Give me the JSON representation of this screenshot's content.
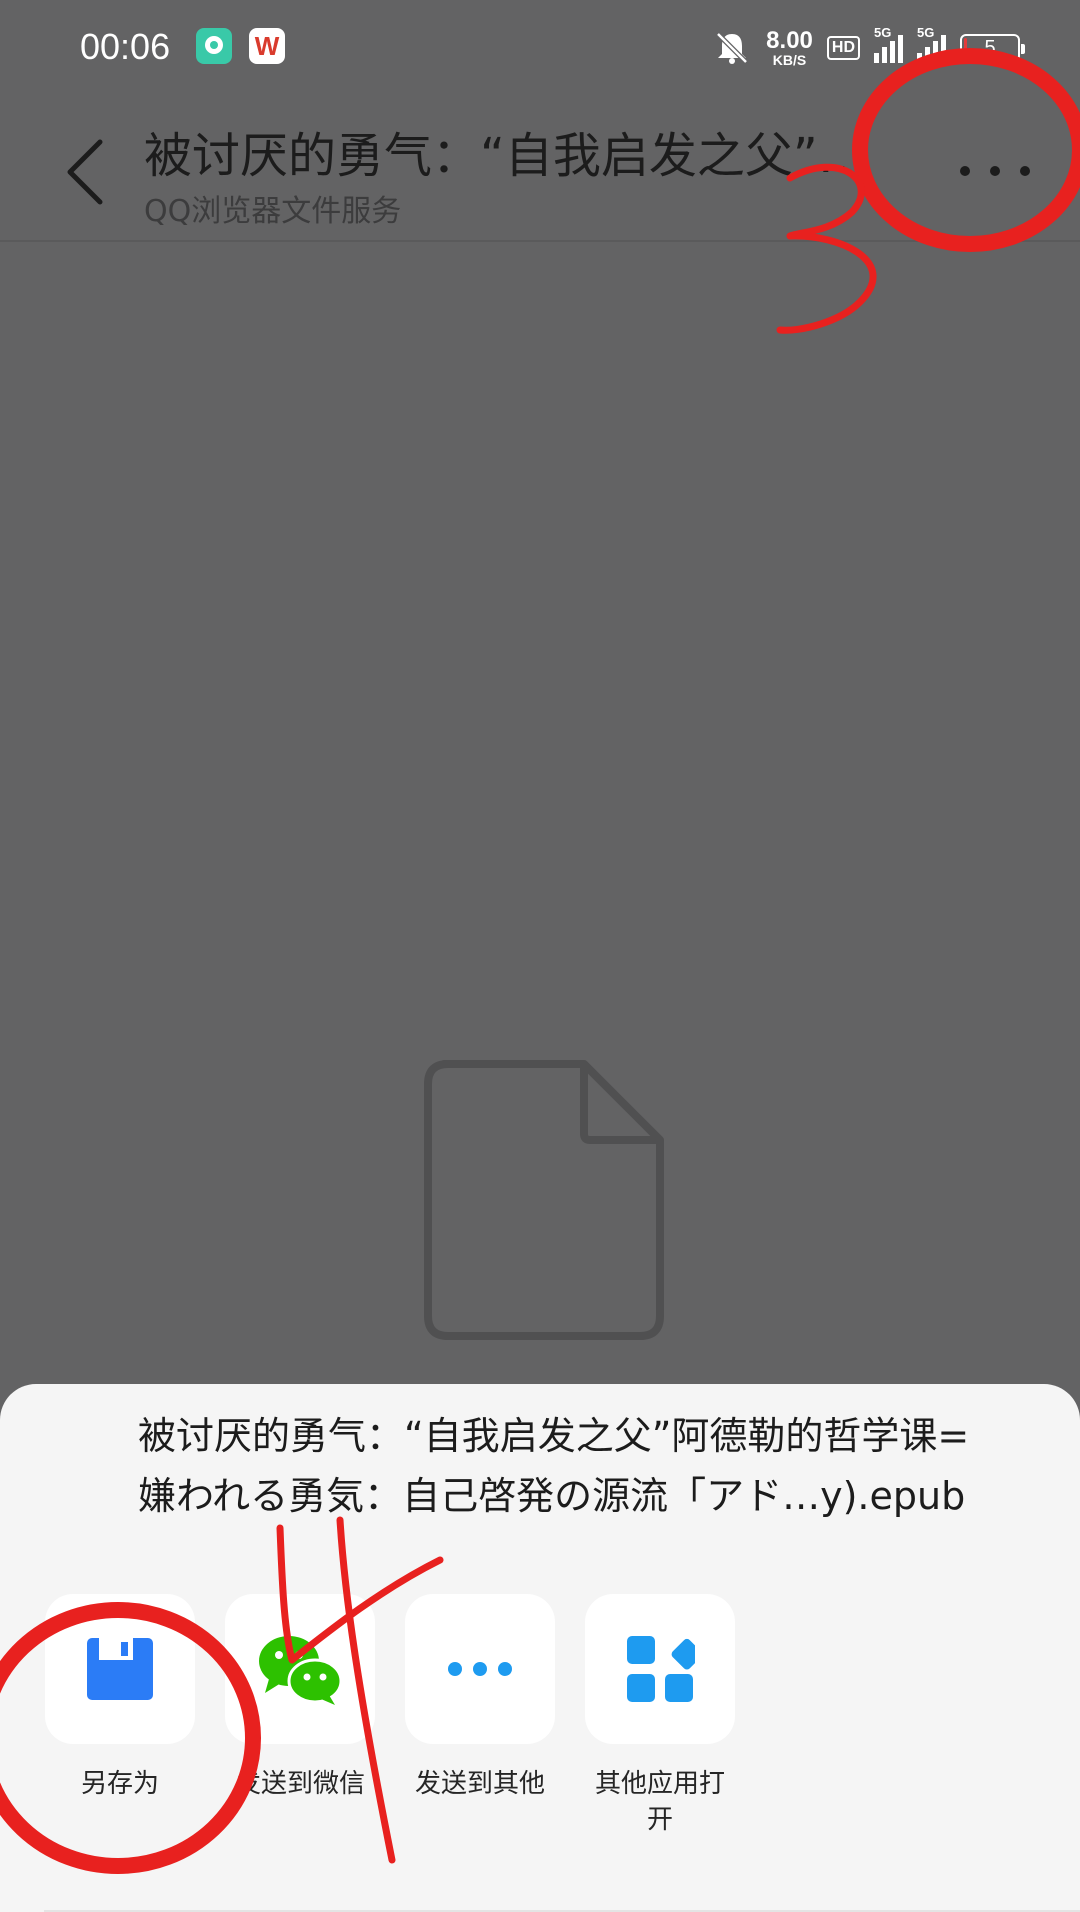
{
  "status_bar": {
    "time": "00:06",
    "net_speed_value": "8.00",
    "net_speed_unit": "KB/S",
    "hd": "HD",
    "sim1_type": "5G",
    "sim2_type": "5G",
    "battery": "5",
    "apps": [
      "qq-app-icon",
      "wps-icon"
    ],
    "battery_color": "#e23b3b"
  },
  "header": {
    "title": "被讨厌的勇气：“自我启发之父”阿德勒的哲学课",
    "subtitle": "QQ浏览器文件服务"
  },
  "sheet": {
    "filename_line1": "被讨厌的勇气：“自我启发之父”阿德勒的哲学课=",
    "filename_line2": "嫌われる勇気：自己啓発の源流「アド…y).epub",
    "actions": [
      {
        "label": "另存为",
        "icon": "save-icon"
      },
      {
        "label": "发送到微信",
        "icon": "wechat-icon"
      },
      {
        "label": "发送到其他",
        "icon": "more-dots-icon"
      },
      {
        "label": "其他应用打开",
        "icon": "apps-grid-icon"
      }
    ]
  },
  "annotations": {
    "step3": "3",
    "step4": "4",
    "color": "#e8211f"
  },
  "colors": {
    "save_blue": "#2b7cf6",
    "wechat_green": "#2dc100",
    "accent_blue": "#1e9bf0"
  }
}
